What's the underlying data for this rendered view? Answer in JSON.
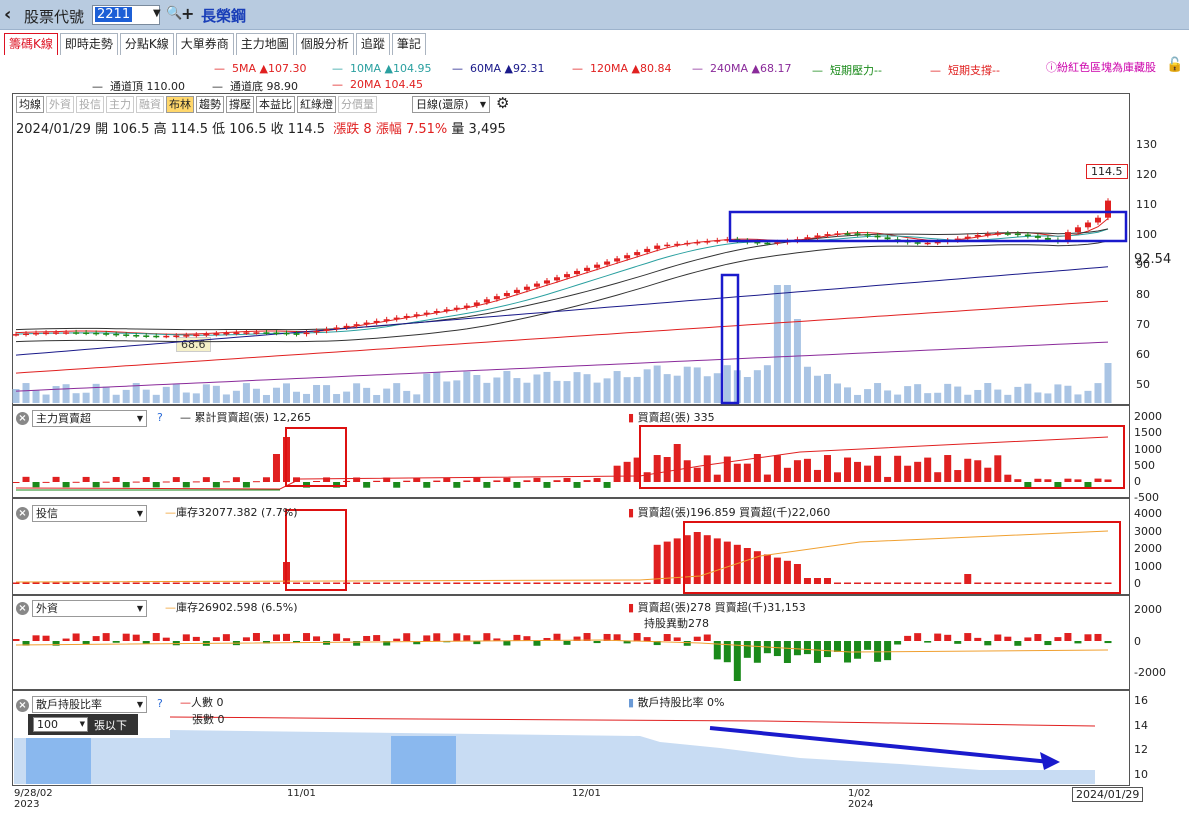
{
  "topbar": {
    "stock_label": "股票代號",
    "code": "2211",
    "name": "長榮鋼"
  },
  "tabs": [
    "籌碼K線",
    "即時走勢",
    "分點K線",
    "大單券商",
    "主力地圖",
    "個股分析",
    "追蹤",
    "筆記"
  ],
  "ma_legend": {
    "ma5": "5MA ▲107.30",
    "ma10": "10MA ▲104.95",
    "ma60": "60MA ▲92.31",
    "ma120": "120MA ▲80.84",
    "ma240": "240MA ▲68.17",
    "short_pressure": "短期壓力--",
    "short_support": "短期支撐--",
    "channel_top": "通道頂 110.00",
    "channel_bottom": "通道底 98.90",
    "ma20": "20MA 104.45",
    "hint": "紛紅色區塊為庫藏股"
  },
  "indicators": [
    "均線",
    "外資",
    "投信",
    "主力",
    "融資",
    "布林",
    "趨勢",
    "撐壓",
    "本益比",
    "紅綠燈",
    "分價量"
  ],
  "period": "日線(還原)",
  "ohlc": {
    "date": "2024/01/29",
    "open_label": "開",
    "open": "106.5",
    "high_label": "高",
    "high": "114.5",
    "low_label": "低",
    "low": "106.5",
    "close_label": "收",
    "close": "114.5",
    "change": "漲跌 8",
    "pct": "漲幅 7.51%",
    "vol_label": "量",
    "vol": "3,495"
  },
  "price_labels": {
    "last": "114.5",
    "ma60": "92.54",
    "low_mark": "68.6"
  },
  "price_axis": [
    "130",
    "120",
    "110",
    "100",
    "90",
    "80",
    "70",
    "60",
    "50"
  ],
  "panels": {
    "main_force": {
      "select": "主力買賣超",
      "help": "?",
      "legend_cum": "累計買賣超(張) 12,265",
      "legend_bar": "買賣超(張) 335",
      "axis": [
        "2000",
        "1500",
        "1000",
        "500",
        "0",
        "-500"
      ]
    },
    "trust": {
      "select": "投信",
      "legend_inv": "庫存32077.382 (7.7%)",
      "legend_bar": "買賣超(張)196.859 買賣超(千)22,060",
      "axis": [
        "4000",
        "3000",
        "2000",
        "1000",
        "0"
      ]
    },
    "foreign": {
      "select": "外資",
      "legend_inv": "庫存26902.598 (6.5%)",
      "legend_bar": "買賣超(張)278 買賣超(千)31,153",
      "legend_change": "持股異動278",
      "axis": [
        "2000",
        "0",
        "-2000"
      ]
    },
    "retail": {
      "select": "散戶持股比率",
      "help": "?",
      "legend_people": "人數 0",
      "legend_shares": "張數 0",
      "legend_ratio": "散戶持股比率 0%",
      "lots_value": "100",
      "lots_label": "張以下",
      "axis": [
        "16",
        "14",
        "12",
        "10"
      ]
    }
  },
  "dates": {
    "d1": "9/28/02",
    "d1y": "2023",
    "d2": "11/01",
    "d3": "12/01",
    "d4": "1/02",
    "d4y": "2024",
    "last": "2024/01/29"
  },
  "colors": {
    "up": "#e02020",
    "down": "#1a8a1a",
    "volume": "#a9c4e4",
    "box": "#1a1acc"
  }
}
